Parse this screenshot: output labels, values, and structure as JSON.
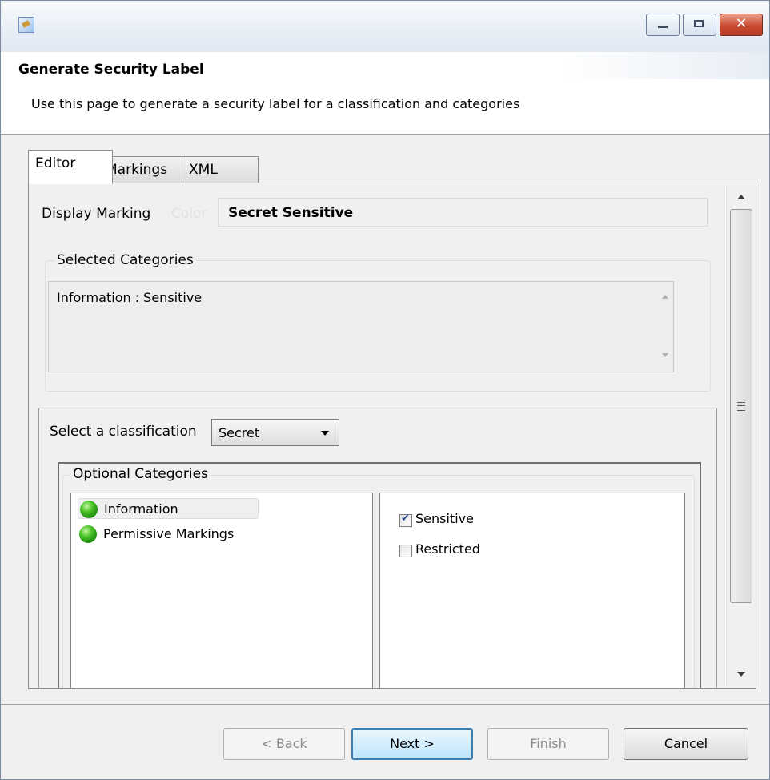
{
  "window": {
    "title": "",
    "app_icon": "wizard-icon",
    "controls": {
      "minimize": "minimize-icon",
      "maximize": "maximize-icon",
      "close": "close-icon",
      "close_glyph": "✕"
    }
  },
  "header": {
    "title": "Generate Security Label",
    "description": "Use this page to generate a security label for a classification and categories"
  },
  "tabs": [
    {
      "label": "Editor",
      "active": true
    },
    {
      "label": "Markings",
      "active": false
    },
    {
      "label": "XML",
      "active": false
    }
  ],
  "editor": {
    "display_marking_label": "Display Marking",
    "color_label": "Color",
    "display_marking_value": "Secret Sensitive",
    "selected_categories": {
      "legend": "Selected Categories",
      "items": [
        "Information : Sensitive"
      ]
    },
    "classification": {
      "label": "Select a classification",
      "value": "Secret"
    },
    "optional_categories": {
      "legend": "Optional Categories",
      "tree": [
        {
          "label": "Information",
          "selected": true,
          "icon": "green-orb-icon"
        },
        {
          "label": "Permissive Markings",
          "selected": false,
          "icon": "green-orb-icon"
        }
      ],
      "checkboxes": [
        {
          "label": "Sensitive",
          "checked": true
        },
        {
          "label": "Restricted",
          "checked": false
        }
      ]
    }
  },
  "footer": {
    "back": "< Back",
    "next": "Next >",
    "finish": "Finish",
    "cancel": "Cancel"
  },
  "colors": {
    "background": "#f0f0f0",
    "accent_border": "#3c7fb1",
    "disabled_text": "#8d8d8d",
    "orb_green": "#1d8a0d"
  }
}
